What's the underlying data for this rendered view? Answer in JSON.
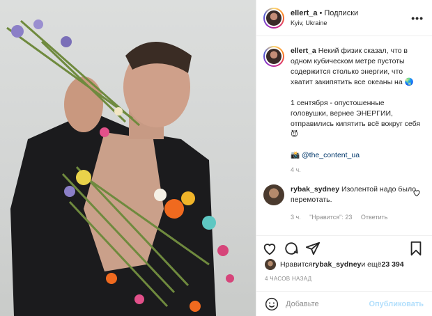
{
  "post": {
    "username": "ellert_a",
    "separator": "•",
    "follow_label": "Подписки",
    "location": "Kyiv, Ukraine",
    "more_label": "•••"
  },
  "caption": {
    "username": "ellert_a",
    "text_line1": " Некий физик сказал, что в одном кубическом метре пустоты содержится столько энергии, что хватит закипятить все океаны на 🌏",
    "text_line2": "1 сентября - опустошенные головушки, вернее ЭНЕРГИИ, отправились кипятить всё вокруг себя😈",
    "camera_emoji": "📸",
    "mention": "@the_content_ua",
    "time": "4 ч."
  },
  "comment": {
    "username": "rybak_sydney",
    "text": " Изолентой надо было перемотать.",
    "time": "3 ч.",
    "likes": "\"Нравится\": 23",
    "reply_label": "Ответить"
  },
  "likes": {
    "prefix": "Нравится ",
    "user": "rybak_sydney",
    "middle": " и ещё ",
    "count": "23 394"
  },
  "time_ago": "4 ЧАСОВ НАЗАД",
  "add_comment": {
    "placeholder": "Добавьте",
    "publish_label": "Опубликовать"
  },
  "colors": {
    "link": "#00376b",
    "muted": "#8e8e8e",
    "publish_disabled": "#b2dffc"
  }
}
